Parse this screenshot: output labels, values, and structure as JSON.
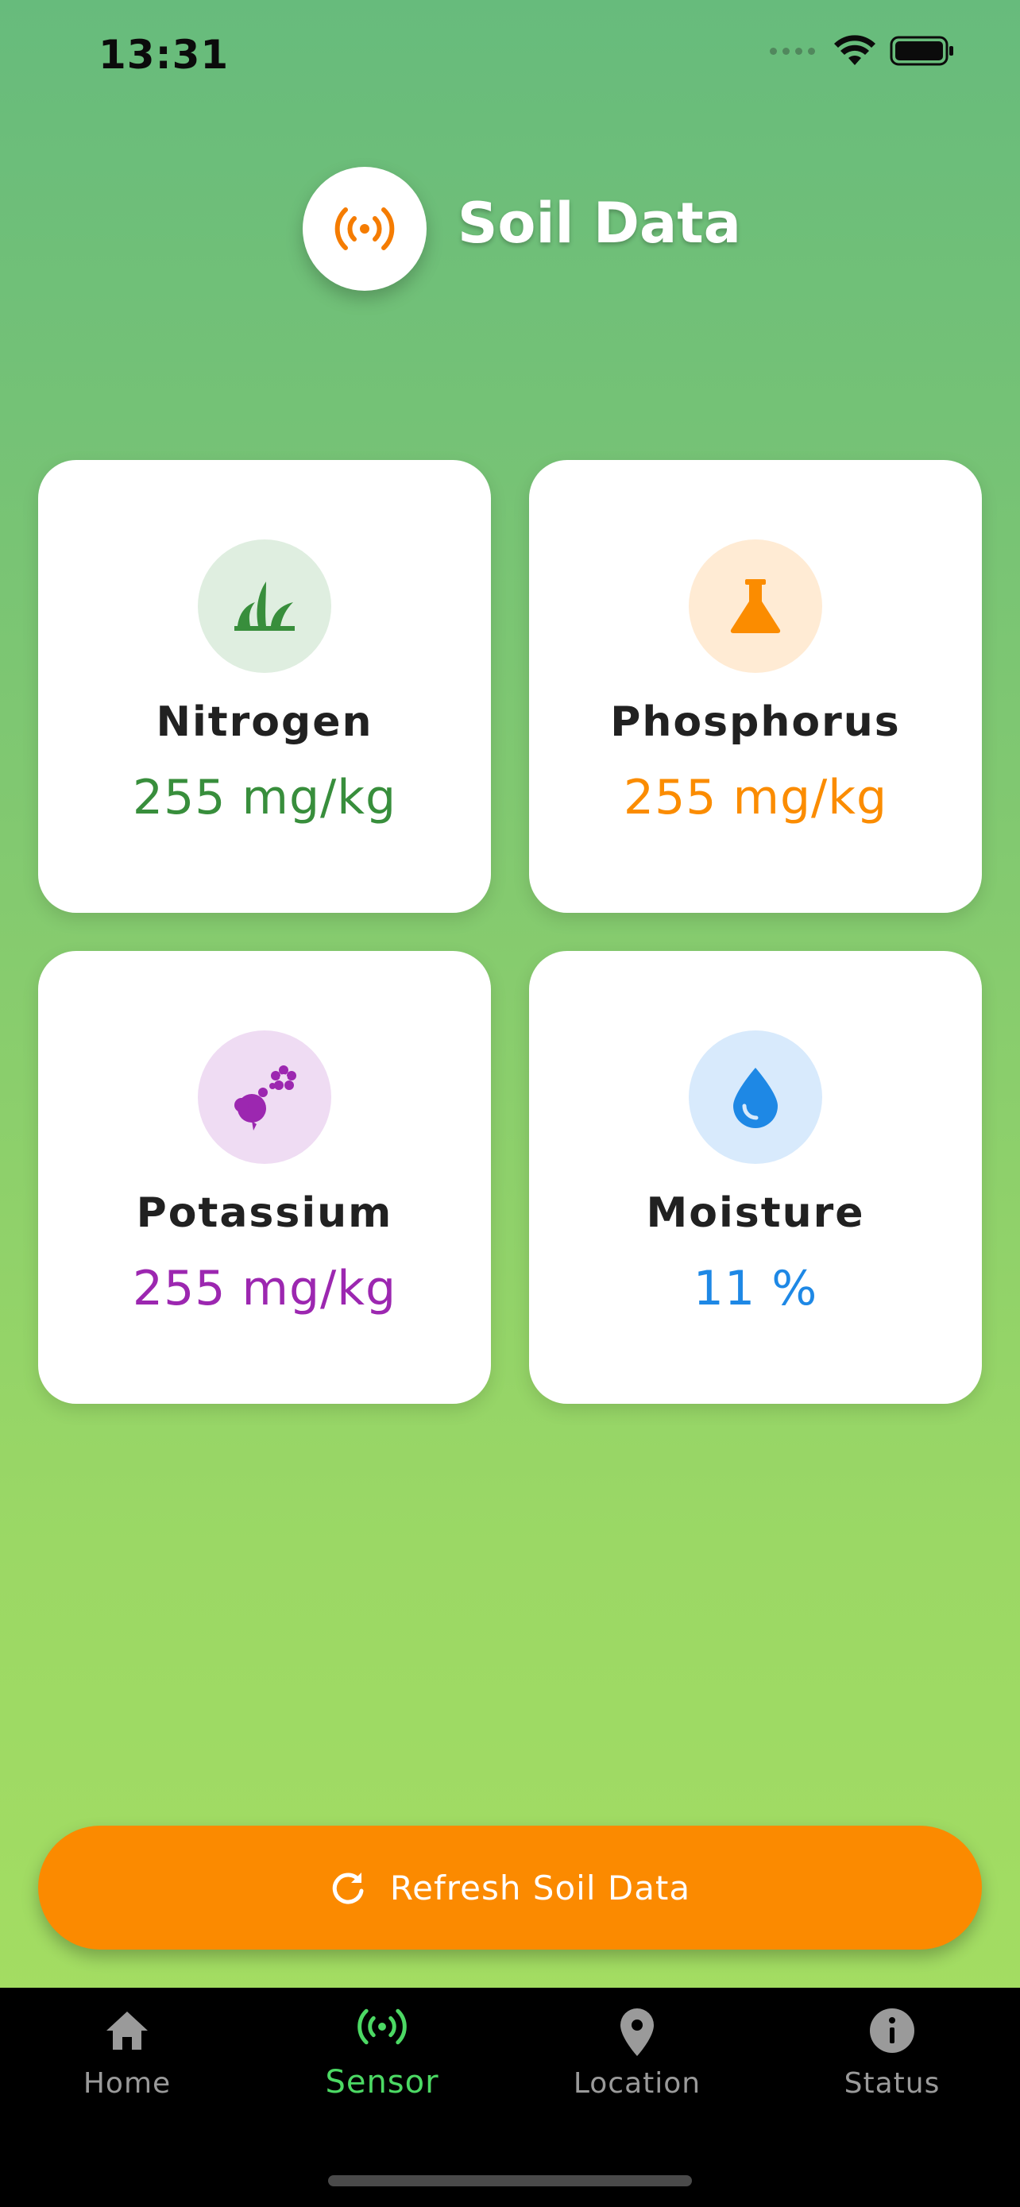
{
  "status_bar": {
    "time": "13:31"
  },
  "header": {
    "title": "Soil Data",
    "icon": "sensors-icon",
    "icon_color": "#f57c00"
  },
  "cards": {
    "nitrogen": {
      "label": "Nitrogen",
      "value": "255 mg/kg",
      "icon": "grass-icon",
      "color": "#388e3c",
      "bg": "#dfeee0"
    },
    "phosphorus": {
      "label": "Phosphorus",
      "value": "255 mg/kg",
      "icon": "flask-icon",
      "color": "#fb8c00",
      "bg": "#ffebd4"
    },
    "potassium": {
      "label": "Potassium",
      "value": "255 mg/kg",
      "icon": "fertilizer-icon",
      "color": "#9c27b0",
      "bg": "#efdcf3"
    },
    "moisture": {
      "label": "Moisture",
      "value": "11 %",
      "icon": "water-drop-icon",
      "color": "#1e88e5",
      "bg": "#d8eafc"
    }
  },
  "refresh_button": {
    "label": "Refresh Soil Data",
    "icon": "refresh-icon",
    "color": "#fb8a00"
  },
  "bottom_nav": {
    "items": [
      {
        "label": "Home",
        "icon": "home-icon",
        "active": false
      },
      {
        "label": "Sensor",
        "icon": "sensors-icon",
        "active": true
      },
      {
        "label": "Location",
        "icon": "location-pin-icon",
        "active": false
      },
      {
        "label": "Status",
        "icon": "info-icon",
        "active": false
      }
    ],
    "active_color": "#4cd964",
    "inactive_color": "#9a9a9a"
  }
}
